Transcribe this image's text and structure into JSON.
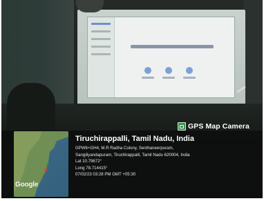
{
  "watermark": {
    "brand": "GPS Map Camera",
    "icon": "gallery-icon"
  },
  "location": {
    "title": "Tiruchirappalli, Tamil Nadu, India",
    "address_line1": "GPW6+GH4, M.R Radha Colony, Senthaneerpuram,",
    "address_line2": "Sangiliyandapuram, Tiruchirappalli, Tamil Nadu 620004, India",
    "latitude": "Lat 10.79672°",
    "longitude": "Long 78.714415°",
    "timestamp": "07/02/23 03:28 PM GMT +05:30"
  },
  "map": {
    "attribution": "Google",
    "water_color": "#3a6784",
    "land_color": "#6f8f55"
  }
}
